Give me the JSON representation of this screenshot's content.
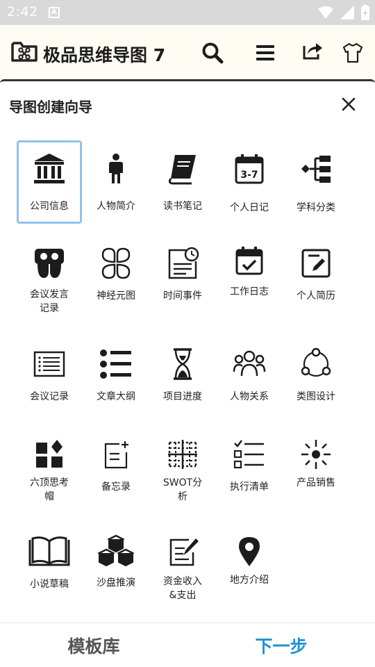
{
  "status_bar": {
    "time": "2:42",
    "notification_letter": "A"
  },
  "header": {
    "title": "极品思维导图 7"
  },
  "wizard": {
    "title": "导图创建向导",
    "templates": [
      {
        "label": "公司信息",
        "icon": "bank-icon",
        "selected": true
      },
      {
        "label": "人物简介",
        "icon": "person-icon"
      },
      {
        "label": "读书笔记",
        "icon": "book-icon"
      },
      {
        "label": "个人日记",
        "icon": "calendar-icon"
      },
      {
        "label": "学科分类",
        "icon": "hierarchy-icon"
      },
      {
        "label": "会议发言\n记录",
        "icon": "speech-icon"
      },
      {
        "label": "神经元图",
        "icon": "clover-icon"
      },
      {
        "label": "时间事件",
        "icon": "clock-document-icon"
      },
      {
        "label": "工作日志",
        "icon": "calendar-check-icon"
      },
      {
        "label": "个人简历",
        "icon": "edit-note-icon"
      },
      {
        "label": "会议记录",
        "icon": "list-box-icon"
      },
      {
        "label": "文章大纲",
        "icon": "bullet-list-icon"
      },
      {
        "label": "项目进度",
        "icon": "hourglass-icon"
      },
      {
        "label": "人物关系",
        "icon": "group-icon"
      },
      {
        "label": "类图设计",
        "icon": "network-icon"
      },
      {
        "label": "六顶思考\n帽",
        "icon": "shapes-icon"
      },
      {
        "label": "备忘录",
        "icon": "memo-icon"
      },
      {
        "label": "SWOT分\n析",
        "icon": "grid-icon"
      },
      {
        "label": "执行清单",
        "icon": "checklist-icon"
      },
      {
        "label": "产品销售",
        "icon": "spark-icon"
      },
      {
        "label": "小说草稿",
        "icon": "open-book-icon"
      },
      {
        "label": "沙盘推演",
        "icon": "cubes-icon"
      },
      {
        "label": "资金收入\n&支出",
        "icon": "sign-document-icon"
      },
      {
        "label": "地方介绍",
        "icon": "location-pin-icon"
      }
    ]
  },
  "footer": {
    "templates_label": "模板库",
    "next_label": "下一步"
  }
}
